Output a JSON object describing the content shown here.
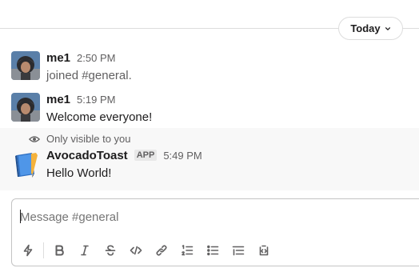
{
  "day_divider": {
    "label": "Today"
  },
  "messages": [
    {
      "sender": "me1",
      "time": "2:50 PM",
      "text": "joined #general."
    },
    {
      "sender": "me1",
      "time": "5:19 PM",
      "text": "Welcome everyone!"
    }
  ],
  "ephemeral": {
    "notice": "Only visible to you",
    "sender": "AvocadoToast",
    "badge": "APP",
    "time": "5:49 PM",
    "text": "Hello World!"
  },
  "composer": {
    "placeholder": "Message #general",
    "toolbar": [
      "shortcuts-icon",
      "bold-icon",
      "italic-icon",
      "strikethrough-icon",
      "code-icon",
      "link-icon",
      "ordered-list-icon",
      "bulleted-list-icon",
      "blockquote-icon",
      "code-block-icon"
    ]
  },
  "colors": {
    "text": "#1d1c1d",
    "muted": "#616061",
    "ephemeral_bg": "#f8f8f8",
    "border": "#dddddd"
  }
}
